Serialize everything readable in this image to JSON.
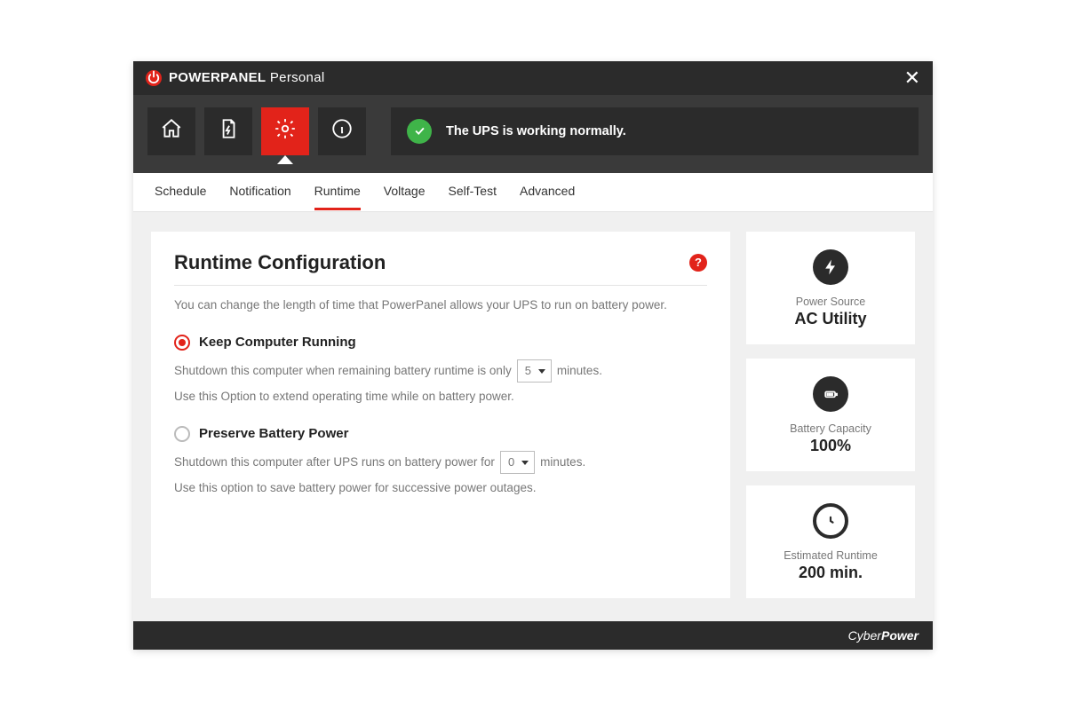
{
  "brand": {
    "bold": "POWERPANEL",
    "light": "Personal"
  },
  "status": {
    "text": "The UPS is working normally."
  },
  "tabs": {
    "schedule": "Schedule",
    "notification": "Notification",
    "runtime": "Runtime",
    "voltage": "Voltage",
    "selftest": "Self-Test",
    "advanced": "Advanced"
  },
  "panel": {
    "title": "Runtime Configuration",
    "desc": "You can change the length of time that PowerPanel allows your UPS to run on battery power.",
    "opt1": {
      "title": "Keep Computer Running",
      "line_a": "Shutdown this computer when remaining battery runtime is only",
      "value": "5",
      "line_b": "minutes.",
      "hint": "Use this Option to extend operating time while on battery power."
    },
    "opt2": {
      "title": "Preserve Battery Power",
      "line_a": "Shutdown this computer after UPS runs on battery power for",
      "value": "0",
      "line_b": "minutes.",
      "hint": "Use this option to save battery power for successive power outages."
    }
  },
  "side": {
    "power_source": {
      "label": "Power Source",
      "value": "AC Utility"
    },
    "battery": {
      "label": "Battery Capacity",
      "value": "100%"
    },
    "runtime": {
      "label": "Estimated Runtime",
      "value": "200 min."
    }
  },
  "help_glyph": "?",
  "close_glyph": "✕",
  "footer": {
    "a": "Cyber",
    "b": "Power"
  }
}
